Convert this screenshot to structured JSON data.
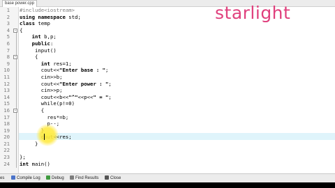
{
  "tab": {
    "label": "base power.cpp"
  },
  "watermark": "starlight",
  "editor": {
    "lines": [
      {
        "num": "1",
        "fold": "",
        "tokens": [
          {
            "t": "#include<iostream>",
            "c": "dir"
          }
        ]
      },
      {
        "num": "2",
        "fold": "",
        "tokens": [
          {
            "t": "using namespace ",
            "c": "kw"
          },
          {
            "t": "std;",
            "c": "plain"
          }
        ]
      },
      {
        "num": "3",
        "fold": "",
        "tokens": [
          {
            "t": "class ",
            "c": "kw"
          },
          {
            "t": "temp",
            "c": "plain"
          }
        ]
      },
      {
        "num": "4",
        "fold": "-",
        "tokens": [
          {
            "t": "{",
            "c": "plain"
          }
        ]
      },
      {
        "num": "5",
        "fold": "",
        "tokens": [
          {
            "t": "    ",
            "c": "plain"
          },
          {
            "t": "int ",
            "c": "kw"
          },
          {
            "t": "b,p;",
            "c": "plain"
          }
        ]
      },
      {
        "num": "6",
        "fold": "",
        "tokens": [
          {
            "t": "    ",
            "c": "plain"
          },
          {
            "t": "public",
            "c": "kw"
          },
          {
            "t": ":",
            "c": "plain"
          }
        ]
      },
      {
        "num": "7",
        "fold": "",
        "tokens": [
          {
            "t": "     input()",
            "c": "plain"
          }
        ]
      },
      {
        "num": "8",
        "fold": "-",
        "tokens": [
          {
            "t": "     {",
            "c": "plain"
          }
        ]
      },
      {
        "num": "9",
        "fold": "",
        "tokens": [
          {
            "t": "       ",
            "c": "plain"
          },
          {
            "t": "int ",
            "c": "kw"
          },
          {
            "t": "res=1;",
            "c": "plain"
          }
        ]
      },
      {
        "num": "10",
        "fold": "",
        "tokens": [
          {
            "t": "       cout<<",
            "c": "plain"
          },
          {
            "t": "\"Enter base : \"",
            "c": "str"
          },
          {
            "t": ";",
            "c": "plain"
          }
        ]
      },
      {
        "num": "11",
        "fold": "",
        "tokens": [
          {
            "t": "       cin>>b;",
            "c": "plain"
          }
        ]
      },
      {
        "num": "12",
        "fold": "",
        "tokens": [
          {
            "t": "       cout<<",
            "c": "plain"
          },
          {
            "t": "\"Enter power : \"",
            "c": "str"
          },
          {
            "t": ";",
            "c": "plain"
          }
        ]
      },
      {
        "num": "13",
        "fold": "",
        "tokens": [
          {
            "t": "       cin>>p;",
            "c": "plain"
          }
        ]
      },
      {
        "num": "14",
        "fold": "",
        "tokens": [
          {
            "t": "       cout<<b<<",
            "c": "plain"
          },
          {
            "t": "\"^\"",
            "c": "str"
          },
          {
            "t": "<<p<<",
            "c": "plain"
          },
          {
            "t": "\" = \"",
            "c": "str"
          },
          {
            "t": ";",
            "c": "plain"
          }
        ]
      },
      {
        "num": "15",
        "fold": "",
        "tokens": [
          {
            "t": "       while(p!=0)",
            "c": "plain"
          }
        ]
      },
      {
        "num": "16",
        "fold": "-",
        "tokens": [
          {
            "t": "       {",
            "c": "plain"
          }
        ]
      },
      {
        "num": "17",
        "fold": "",
        "tokens": [
          {
            "t": "         res*=b;",
            "c": "plain"
          }
        ]
      },
      {
        "num": "18",
        "fold": "",
        "tokens": [
          {
            "t": "         p--;",
            "c": "plain"
          }
        ]
      },
      {
        "num": "19",
        "fold": "",
        "tokens": [
          {
            "t": "       }",
            "c": "plain"
          }
        ]
      },
      {
        "num": "20",
        "fold": "",
        "tokens": [
          {
            "t": "       cout<<res;",
            "c": "plain"
          }
        ]
      },
      {
        "num": "21",
        "fold": "",
        "tokens": [
          {
            "t": "     }",
            "c": "plain"
          }
        ]
      },
      {
        "num": "22",
        "fold": "",
        "tokens": [
          {
            "t": "",
            "c": "plain"
          }
        ]
      },
      {
        "num": "23",
        "fold": "",
        "tokens": [
          {
            "t": "};",
            "c": "plain"
          }
        ]
      },
      {
        "num": "24",
        "fold": "",
        "tokens": [
          {
            "t": "int ",
            "c": "kw"
          },
          {
            "t": "main()",
            "c": "plain"
          }
        ]
      }
    ]
  },
  "statusbar": {
    "items": [
      {
        "label": "es",
        "icon": "",
        "color": ""
      },
      {
        "label": "Compile Log",
        "icon": "compile-log-icon",
        "color": "#4a73c9"
      },
      {
        "label": "Debug",
        "icon": "debug-icon",
        "color": "#3f9b3f"
      },
      {
        "label": "Find Results",
        "icon": "find-results-icon",
        "color": "#7d7d7d"
      },
      {
        "label": "Close",
        "icon": "close-icon",
        "color": "#555555"
      }
    ]
  }
}
